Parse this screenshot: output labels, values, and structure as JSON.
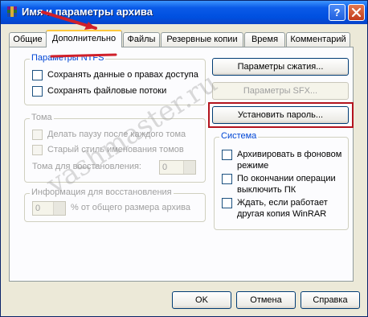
{
  "window": {
    "title": "Имя и параметры архива",
    "help_glyph": "?"
  },
  "tabs": [
    {
      "label": "Общие"
    },
    {
      "label": "Дополнительно"
    },
    {
      "label": "Файлы"
    },
    {
      "label": "Резервные копии"
    },
    {
      "label": "Время"
    },
    {
      "label": "Комментарий"
    }
  ],
  "ntfs": {
    "title": "Параметры NTFS",
    "save_access": "Сохранять данные о правах доступа",
    "save_streams": "Сохранять файловые потоки"
  },
  "volumes": {
    "title": "Тома",
    "pause": "Делать паузу после каждого тома",
    "old_naming": "Старый стиль именования томов",
    "recovery_label": "Тома для восстановления:",
    "recovery_value": "0"
  },
  "recovery": {
    "title": "Информация для восстановления",
    "value": "0",
    "percent_label": "% от общего размера архива"
  },
  "buttons": {
    "compression": "Параметры сжатия...",
    "sfx": "Параметры SFX...",
    "password": "Установить пароль..."
  },
  "system": {
    "title": "Система",
    "background": "Архивировать в фоновом режиме",
    "shutdown": "По окончании операции выключить ПК",
    "wait": "Ждать, если работает другая копия WinRAR"
  },
  "footer": {
    "ok": "OK",
    "cancel": "Отмена",
    "help": "Справка"
  },
  "watermark": "vashmaster.ru",
  "colors": {
    "highlight": "#b3141e",
    "arrow": "#d0202a",
    "titlebar": "#0a5ae8",
    "group_title": "#0046d5"
  }
}
